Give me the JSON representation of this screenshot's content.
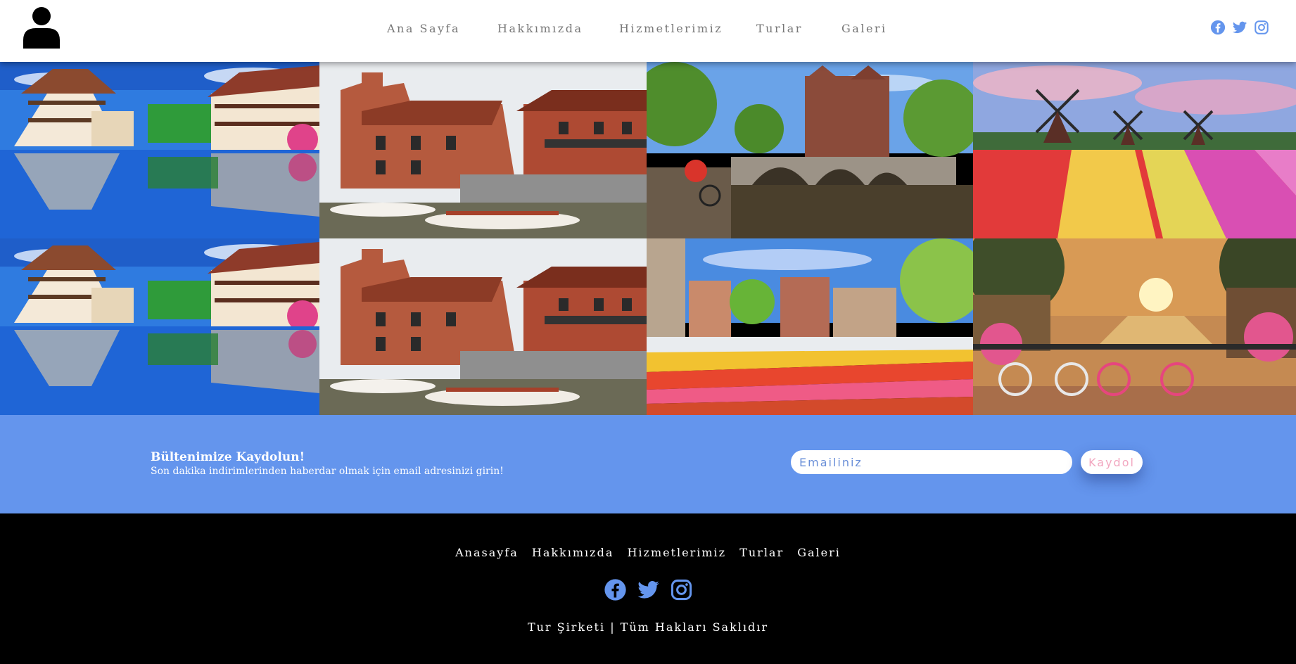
{
  "header": {
    "logo_icon": "user-silhouette-icon",
    "nav": [
      "Ana Sayfa",
      "Hakkımızda",
      "Hizmetlerimiz",
      "Turlar",
      "Galeri"
    ],
    "social_icons": [
      "facebook-icon",
      "twitter-icon",
      "instagram-icon"
    ]
  },
  "gallery": {
    "images": [
      "strasbourg-petite-france-canal",
      "bruges-brick-houses-boats",
      "amsterdam-canal-bridge",
      "windmills-tulip-fields",
      "strasbourg-petite-france-canal",
      "bruges-brick-houses-boats",
      "amsterdam-tulip-market",
      "amsterdam-canal-bicycles-sunset"
    ]
  },
  "newsletter": {
    "title": "Bültenimize Kaydolun!",
    "subtitle": "Son dakika indirimlerinden haberdar olmak için email adresinizi girin!",
    "email_placeholder": "Emailiniz",
    "button_label": "Kaydol"
  },
  "footer": {
    "nav": [
      "Anasayfa",
      "Hakkımızda",
      "Hizmetlerimiz",
      "Turlar",
      "Galeri"
    ],
    "social_icons": [
      "facebook-icon",
      "twitter-icon",
      "instagram-icon"
    ],
    "copyright": "Tur Şirketi | Tüm Hakları Saklıdır"
  },
  "colors": {
    "accent": "#6495ed",
    "nav_text": "#777777",
    "button_text": "#f2a7c0",
    "footer_bg": "#000000"
  }
}
